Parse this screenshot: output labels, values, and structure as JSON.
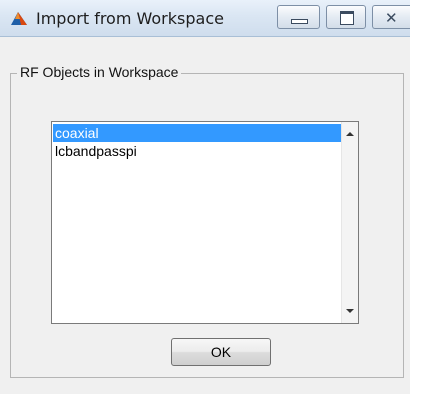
{
  "window": {
    "title": "Import from Workspace"
  },
  "titlebar_buttons": {
    "minimize_icon": "minimize-icon",
    "maximize_icon": "maximize-icon",
    "close_icon": "close-icon",
    "close_glyph": "✕"
  },
  "group": {
    "title": "RF Objects in Workspace"
  },
  "list": {
    "items": [
      {
        "label": "coaxial",
        "selected": true
      },
      {
        "label": "lcbandpasspi",
        "selected": false
      }
    ]
  },
  "actions": {
    "ok_label": "OK"
  },
  "colors": {
    "selection": "#3399ff",
    "matlab_icon": "#d9480f"
  }
}
